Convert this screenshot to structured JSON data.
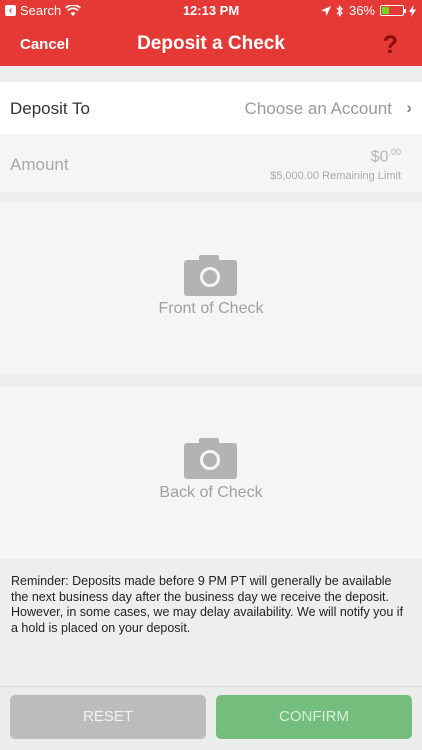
{
  "status_bar": {
    "back_app": "Search",
    "time": "12:13 PM",
    "battery": "36%"
  },
  "nav": {
    "cancel": "Cancel",
    "title": "Deposit a Check",
    "help": "?"
  },
  "deposit_to": {
    "label": "Deposit To",
    "value": "Choose an Account"
  },
  "amount": {
    "label": "Amount",
    "value_whole": "$0",
    "value_cents": ".00",
    "remaining": "$5,000.00 Remaining Limit"
  },
  "front": {
    "label": "Front of Check"
  },
  "back": {
    "label": "Back of Check"
  },
  "reminder": "Reminder: Deposits made before 9 PM PT will generally be available the next business day after the business day we receive the deposit. However, in some cases, we may delay availability. We will notify you if a hold is placed on your deposit.",
  "buttons": {
    "reset": "RESET",
    "confirm": "CONFIRM"
  },
  "colors": {
    "brand": "#e53935",
    "confirm": "#67b871",
    "reset": "#b7b7b7"
  },
  "battery_level": 0.36
}
